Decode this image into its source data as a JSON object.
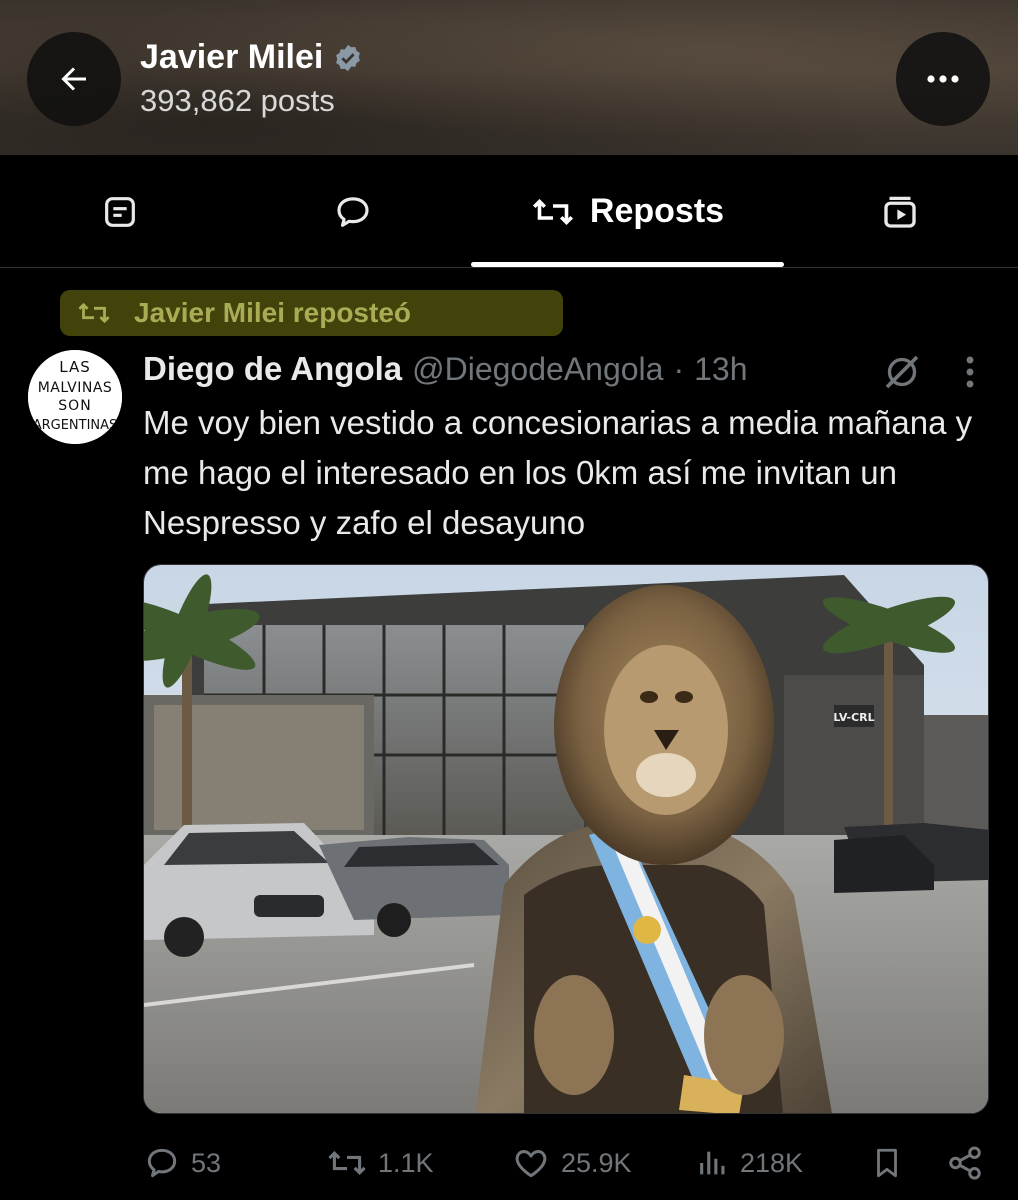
{
  "header": {
    "title": "Javier Milei",
    "posts": "393,862 posts"
  },
  "tabs": [
    {
      "name": "posts",
      "icon": "notes-icon"
    },
    {
      "name": "replies",
      "icon": "comment-icon"
    },
    {
      "name": "reposts",
      "label": "Reposts",
      "icon": "repost-icon",
      "active": true
    },
    {
      "name": "media",
      "icon": "video-icon"
    }
  ],
  "repost_banner": {
    "text": "Javier Milei reposteó"
  },
  "tweet": {
    "author": "Diego de Angola",
    "handle": "@DiegodeAngola",
    "separator": "·",
    "time": "13h",
    "text": "Me voy bien vestido a concesionarias a media mañana y me hago el interesado en los 0km así me invitan un Nespresso y zafo el desayuno",
    "avatar_text": [
      "LAS",
      "MALVINAS",
      "SON",
      "ARGENTINAS"
    ],
    "media": {
      "sign_text": "LV-CRL"
    },
    "stats": {
      "replies": "53",
      "reposts": "1.1K",
      "likes": "25.9K",
      "views": "218K"
    }
  },
  "colors": {
    "accent_text": "#e7e9ea",
    "muted": "#71767b",
    "highlight": "#a9ac55"
  }
}
